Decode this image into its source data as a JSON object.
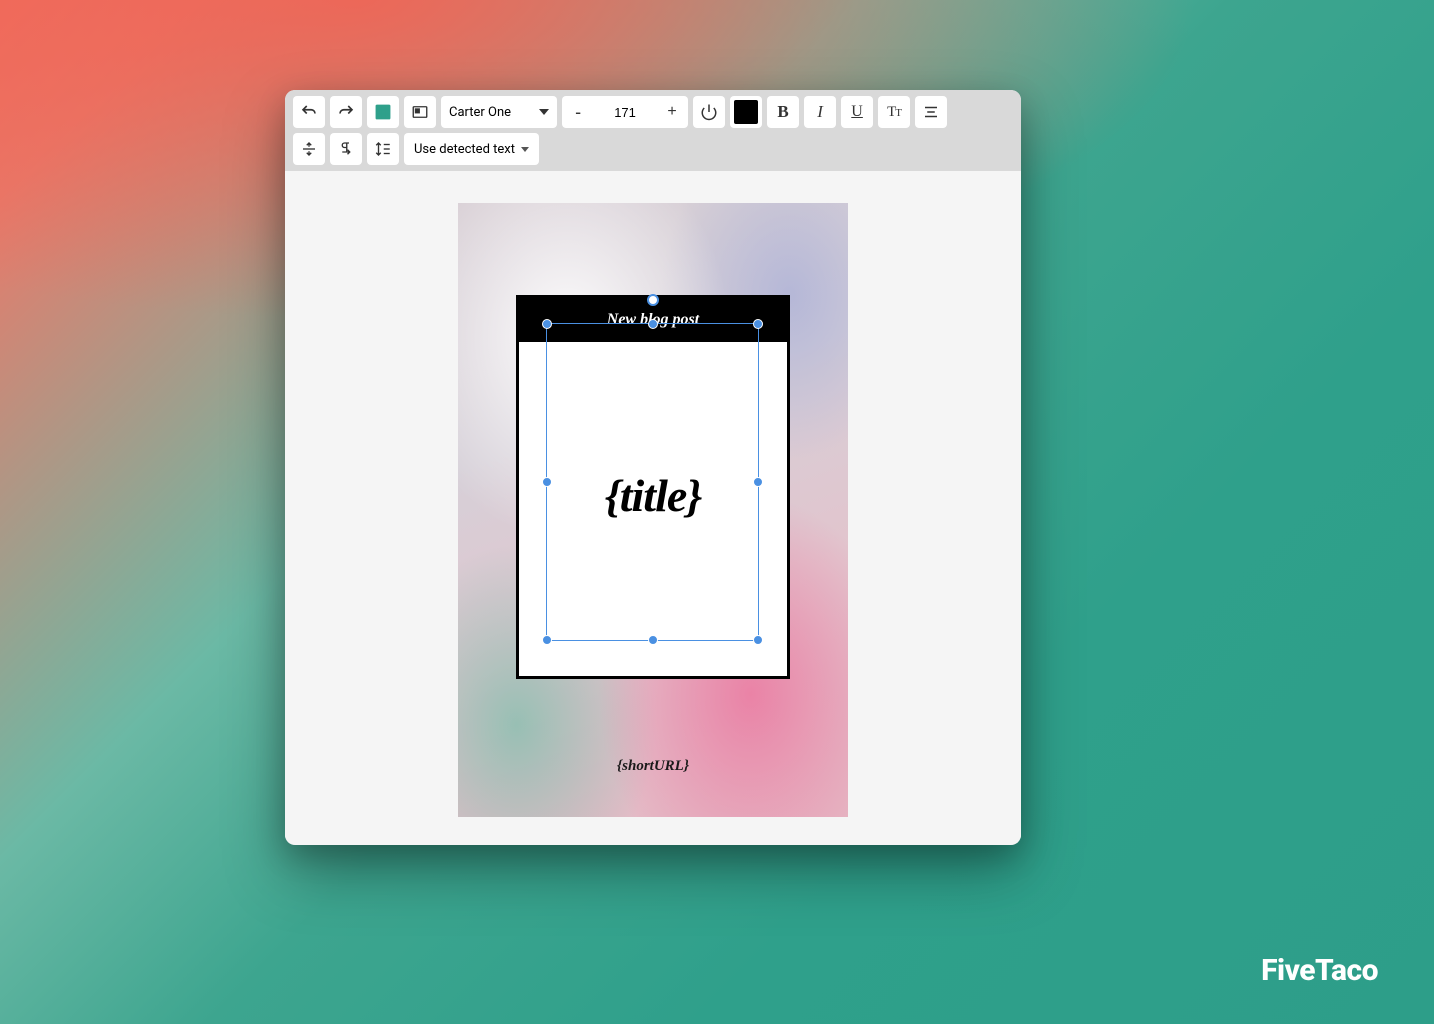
{
  "toolbar": {
    "font_name": "Carter One",
    "font_size": "171",
    "text_detect_label": "Use detected text",
    "color": "#000000"
  },
  "canvas": {
    "card_header": "New blog post",
    "title_placeholder": "{title}",
    "short_url_placeholder": "{shortURL}"
  },
  "watermark": "FiveTaco"
}
